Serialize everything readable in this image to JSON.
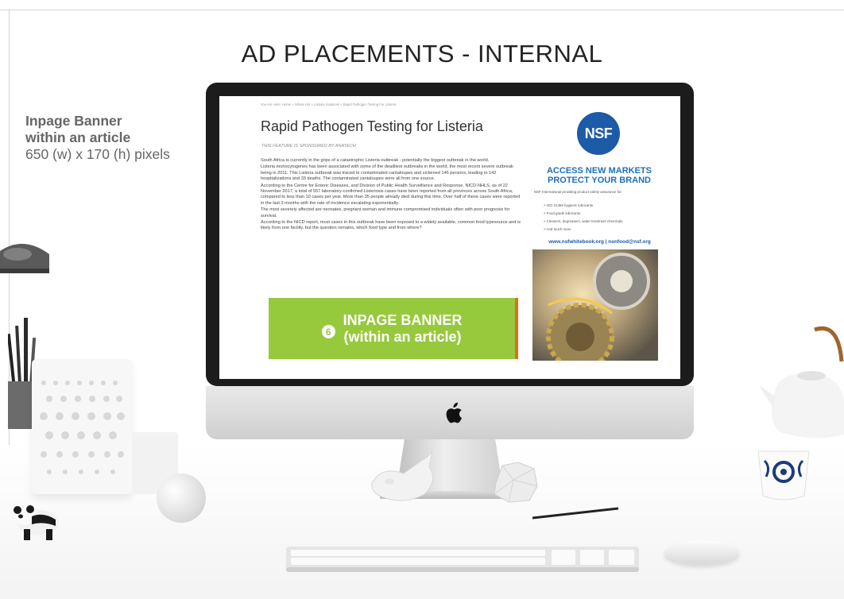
{
  "slide": {
    "title": "AD PLACEMENTS - INTERNAL"
  },
  "caption": {
    "line1": "Inpage Banner",
    "line2": "within an article",
    "line3": "650 (w) x 170 (h) pixels"
  },
  "article": {
    "breadcrumb": "You Are Here:  Home  »  Whats Hot  »  Listeria Solutions  »  Rapid Pathogen Testing For Listeria",
    "title": "Rapid Pathogen Testing for Listeria",
    "sponsor": "THIS FEATURE IS SPONSORED BY ANATECH",
    "paragraphs": [
      "South Africa is currently in the grips of a catastrophic Listeria outbreak - potentially the biggest  outbreak in the world.",
      "Listeria monocytogenes has been associated with some of the deadliest outbreaks in the world, the most recent severe outbreak being in 2011. This Listeria outbreak was traced to contaminated cantaloupes and sickened 146 persons, leading to 142 hospitalizations and 33 deaths. The contaminated cantaloupes were all from one source.",
      "According to the Centre for Enteric Diseases, and Division of Public Health Surveillance and Response, NICD-NHLS, as of 22 November 2017, a total of 557 laboratory-confirmed Listeriosis cases have been reported from all provinces across South Africa, compared to less than 10 cases per year. More than 35 people already died during this time. Over half of these cases were reported in the last 3 months with the rate of incidence escalating exponentially.",
      "The most severely affected are neonates, pregnant woman and immune compromised individuals often with poor prognosis for survival.",
      "According to the NICD report, most cases in this outbreak have been exposed to a widely available, common food typesource and is likely from one facility, but the question remains, which food type and from where?"
    ]
  },
  "banner": {
    "number": "6",
    "line1": "INPAGE BANNER",
    "line2": "(within an article)",
    "color": "#97c93d"
  },
  "sidebar_ad": {
    "logo": "NSF",
    "headline1": "ACCESS NEW MARKETS",
    "headline2": "PROTECT YOUR BRAND",
    "copy": "NSF International providing product safety assurance for:",
    "bullets": [
      ">  ISO 21469 hygienic lubricants",
      ">  Food grade lubricants",
      ">  Cleaners, degreasers, water treatment chemicals",
      ">  And much more"
    ],
    "links": "www.nsfwhitebook.org  |  nonfood@nsf.org",
    "brand_color": "#1d5aa8"
  },
  "icons": {
    "apple": "apple-logo-icon"
  }
}
